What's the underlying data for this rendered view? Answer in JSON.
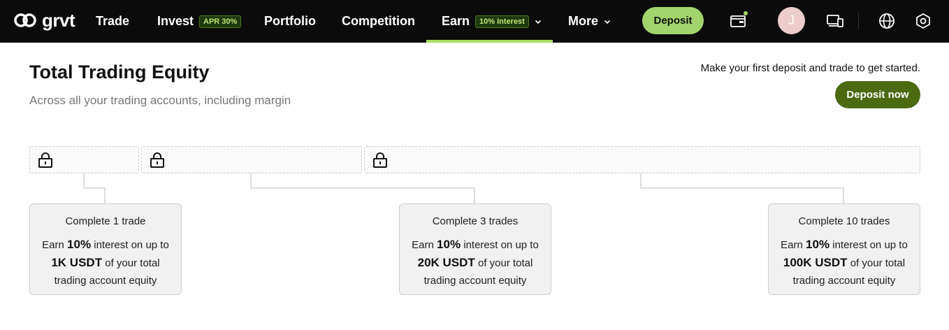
{
  "brand": {
    "name": "grvt",
    "icon": "grvt-logo-icon"
  },
  "nav": {
    "trade": "Trade",
    "invest": "Invest",
    "invest_badge": "APR 30%",
    "portfolio": "Portfolio",
    "competition": "Competition",
    "earn": "Earn",
    "earn_badge": "10% Interest",
    "more": "More",
    "active": "Earn"
  },
  "header": {
    "deposit_label": "Deposit",
    "avatar_initial": "J",
    "icons": [
      "wallet-icon",
      "devices-icon",
      "globe-icon",
      "settings-icon"
    ]
  },
  "page": {
    "title": "Total Trading Equity",
    "subtitle": "Across all your trading accounts, including margin",
    "cta_text": "Make your first deposit and trade to get started.",
    "cta_button": "Deposit now"
  },
  "tiers": [
    {
      "title": "Complete 1 trade",
      "earn": "Earn",
      "rate": "10%",
      "mid": "interest on up to",
      "cap": "1K USDT",
      "tail1": "of your total",
      "tail2": "trading account equity",
      "locked": true
    },
    {
      "title": "Complete 3 trades",
      "earn": "Earn",
      "rate": "10%",
      "mid": "interest on up to",
      "cap": "20K USDT",
      "tail1": "of your total",
      "tail2": "trading account equity",
      "locked": true
    },
    {
      "title": "Complete 10 trades",
      "earn": "Earn",
      "rate": "10%",
      "mid": "interest on up to",
      "cap": "100K USDT",
      "tail1": "of your total",
      "tail2": "trading account equity",
      "locked": true
    }
  ],
  "colors": {
    "accent": "#a3d46c",
    "cta": "#4c6a12",
    "topbar": "#0b0b0b"
  }
}
